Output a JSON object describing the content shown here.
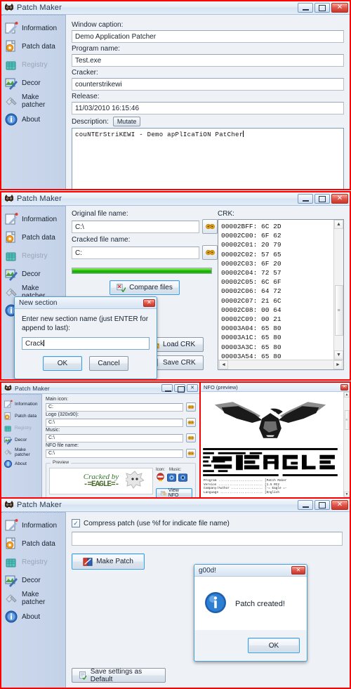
{
  "app": {
    "title": "Patch Maker",
    "icon": "patchmaker-icon",
    "window_buttons": {
      "minimize": "minimize-icon",
      "maximize": "maximize-icon",
      "close": "close-icon"
    }
  },
  "sidebar": {
    "items": [
      {
        "label": "Information",
        "icon": "pencil-note-icon",
        "disabled": false
      },
      {
        "label": "Patch data",
        "icon": "document-gear-icon",
        "disabled": false
      },
      {
        "label": "Registry",
        "icon": "registry-cube-icon",
        "disabled": true
      },
      {
        "label": "Decor",
        "icon": "image-pencil-icon",
        "disabled": false
      },
      {
        "label": "Make patcher",
        "icon": "hammer-icon",
        "disabled": false
      },
      {
        "label": "About",
        "icon": "info-circle-icon",
        "disabled": false
      }
    ]
  },
  "panel_information": {
    "fields": [
      {
        "label": "Window caption:",
        "value": "Demo Application Patcher"
      },
      {
        "label": "Program name:",
        "value": "Test.exe"
      },
      {
        "label": "Cracker:",
        "value": "counterstrikewi"
      },
      {
        "label": "Release:",
        "value": "11/03/2010 16:15:46"
      }
    ],
    "description_label": "Description:",
    "mutate_button": "Mutate",
    "description_value": "couNTErStriKEWI - Demo apPlIcaTiON PatCher"
  },
  "panel_patchdata": {
    "original_label": "Original file name:",
    "original_value": "C:\\",
    "cracked_label": "Cracked file name:",
    "cracked_value": "C:",
    "progress_percent": 100,
    "compare_button": "Compare files",
    "load_button": "Load CRK",
    "save_button": "Save CRK",
    "crk_label": "CRK:",
    "crk_rows": [
      {
        "address": "00002BFF:",
        "bytes": "6C 2D"
      },
      {
        "address": "00002C00:",
        "bytes": "6F 62"
      },
      {
        "address": "00002C01:",
        "bytes": "20 79"
      },
      {
        "address": "00002C02:",
        "bytes": "57 65"
      },
      {
        "address": "00002C03:",
        "bytes": "6F 20"
      },
      {
        "address": "00002C04:",
        "bytes": "72 57"
      },
      {
        "address": "00002C05:",
        "bytes": "6C 6F"
      },
      {
        "address": "00002C06:",
        "bytes": "64 72"
      },
      {
        "address": "00002C07:",
        "bytes": "21 6C"
      },
      {
        "address": "00002C08:",
        "bytes": "00 64"
      },
      {
        "address": "00002C09:",
        "bytes": "00 21"
      },
      {
        "address": "00003A04:",
        "bytes": "65 80"
      },
      {
        "address": "00003A1C:",
        "bytes": "65 80"
      },
      {
        "address": "00003A3C:",
        "bytes": "65 80"
      },
      {
        "address": "00003A54:",
        "bytes": "65 80"
      }
    ],
    "crk_text": "00002BFF: 6C 2D\n00002C00: 6F 62\n00002C01: 20 79\n00002C02: 57 65\n00002C03: 6F 20\n00002C04: 72 57\n00002C05: 6C 6F\n00002C06: 64 72\n00002C07: 21 6C\n00002C08: 00 64\n00002C09: 00 21\n00003A04: 65 80\n00003A1C: 65 80\n00003A3C: 65 80\n00003A54: 65 80"
  },
  "dialog_new_section": {
    "title": "New section",
    "message": "Enter new section name (just ENTER for append to last):",
    "input_value": "Crack",
    "ok_button": "OK",
    "cancel_button": "Cancel"
  },
  "panel_decor": {
    "fields": [
      {
        "label": "Main icon:",
        "value": "C:"
      },
      {
        "label": "Logo (320x90):",
        "value": "C:\\"
      },
      {
        "label": "Music:",
        "value": "C:\\"
      },
      {
        "label": "NFO file name:",
        "value": "C:\\"
      }
    ],
    "preview_label": "Preview",
    "preview_text_top": "Cracked by",
    "preview_text_main": "-=EAGLE=-",
    "icon_label": "Icon:",
    "music_label": "Music:",
    "view_nfo_button": "View NFO"
  },
  "nfo_window": {
    "title": "NFO (preview)",
    "logo_text": "-=EAGLE=-",
    "lines": [
      {
        "key": "Program",
        "value": "[Patch Maker"
      },
      {
        "key": "Version",
        "value": "[1.5 RC2"
      },
      {
        "key": "Company/Author",
        "value": "[-= Eagle =-"
      },
      {
        "key": "Language",
        "value": "[English"
      }
    ],
    "body_text": "Program ........................ [Patch Maker\nVersion ........................ [1.5 RC2\nCompany/Author ................. [-= Eagle =-\nLanguage ....................... [English"
  },
  "panel_makepatcher": {
    "compress_checkbox_label": "Compress patch (use %f for indicate file name)",
    "compress_checked": true,
    "path_value": "",
    "make_patch_button": "Make Patch",
    "save_settings_button": "Save settings as Default"
  },
  "dialog_good": {
    "title": "g00d!",
    "message": "Patch created!",
    "ok_button": "OK",
    "icon": "info-circle-icon"
  },
  "colors": {
    "border_red": "#ff0000",
    "titlebar_blue": "#d5e3f2",
    "sidebar_blue": "#ccd8ec",
    "progress_green": "#2fc713",
    "focus_blue": "#3c9ddf"
  }
}
